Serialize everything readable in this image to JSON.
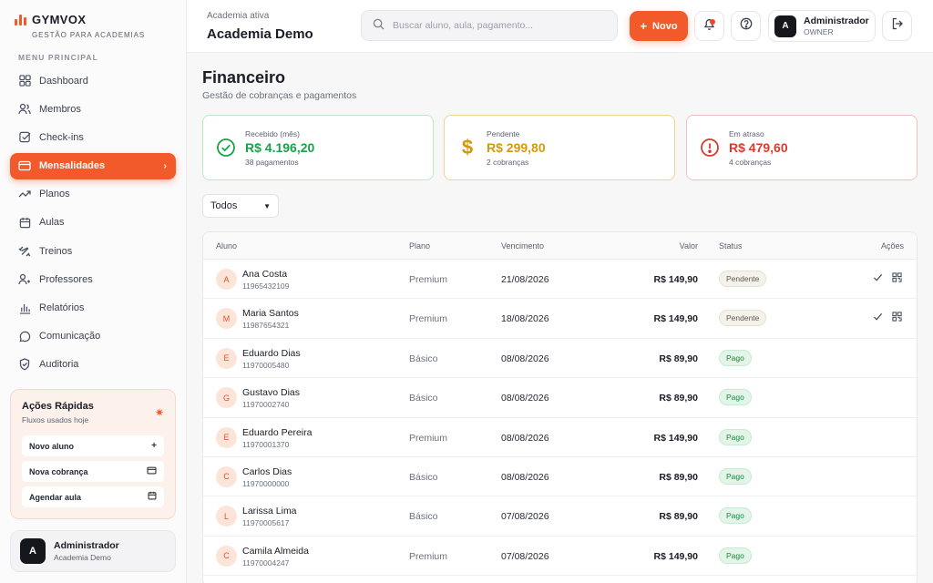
{
  "brand": {
    "name": "GYMVOX",
    "subtitle": "GESTÃO PARA ACADEMIAS"
  },
  "sidebar": {
    "menu_title": "MENU PRINCIPAL",
    "items": [
      {
        "label": "Dashboard",
        "icon": "grid-icon"
      },
      {
        "label": "Membros",
        "icon": "users-icon"
      },
      {
        "label": "Check-ins",
        "icon": "checkbox-icon"
      },
      {
        "label": "Mensalidades",
        "icon": "card-icon",
        "active": true
      },
      {
        "label": "Planos",
        "icon": "trend-icon"
      },
      {
        "label": "Aulas",
        "icon": "calendar-icon"
      },
      {
        "label": "Treinos",
        "icon": "workout-icon"
      },
      {
        "label": "Professores",
        "icon": "teacher-icon"
      },
      {
        "label": "Relatórios",
        "icon": "bars-icon"
      },
      {
        "label": "Comunicação",
        "icon": "chat-icon"
      },
      {
        "label": "Auditoria",
        "icon": "shield-icon"
      }
    ],
    "quick": {
      "title": "Ações Rápidas",
      "subtitle": "Fluxos usados hoje",
      "items": [
        {
          "label": "Novo aluno",
          "icon": "plus-icon"
        },
        {
          "label": "Nova cobrança",
          "icon": "card-icon"
        },
        {
          "label": "Agendar aula",
          "icon": "calendar-icon"
        }
      ]
    },
    "user": {
      "initial": "A",
      "name": "Administrador",
      "org": "Academia Demo"
    }
  },
  "header": {
    "academy_label": "Academia ativa",
    "academy_name": "Academia Demo",
    "search_placeholder": "Buscar aluno, aula, pagamento...",
    "new_label": "Novo",
    "admin": {
      "initial": "A",
      "name": "Administrador",
      "role": "OWNER"
    }
  },
  "page": {
    "title": "Financeiro",
    "subtitle": "Gestão de cobranças e pagamentos"
  },
  "cards": [
    {
      "label": "Recebido (mês)",
      "value": "R$ 4.196,20",
      "sub": "38 pagamentos",
      "color": "#17a34a"
    },
    {
      "label": "Pendente",
      "value": "R$ 299,80",
      "sub": "2 cobranças",
      "color": "#d29a0a"
    },
    {
      "label": "Em atraso",
      "value": "R$ 479,60",
      "sub": "4 cobranças",
      "color": "#d93b2b"
    }
  ],
  "filter": {
    "selected": "Todos"
  },
  "table": {
    "headers": {
      "aluno": "Aluno",
      "plano": "Plano",
      "vencimento": "Vencimento",
      "valor": "Valor",
      "status": "Status",
      "acoes": "Ações"
    },
    "rows": [
      {
        "initial": "A",
        "name": "Ana Costa",
        "phone": "11965432109",
        "plan": "Premium",
        "due": "21/08/2026",
        "value": "R$ 149,90",
        "status": "Pendente"
      },
      {
        "initial": "M",
        "name": "Maria Santos",
        "phone": "11987654321",
        "plan": "Premium",
        "due": "18/08/2026",
        "value": "R$ 149,90",
        "status": "Pendente"
      },
      {
        "initial": "E",
        "name": "Eduardo Dias",
        "phone": "11970005480",
        "plan": "Básico",
        "due": "08/08/2026",
        "value": "R$ 89,90",
        "status": "Pago"
      },
      {
        "initial": "G",
        "name": "Gustavo Dias",
        "phone": "11970002740",
        "plan": "Básico",
        "due": "08/08/2026",
        "value": "R$ 89,90",
        "status": "Pago"
      },
      {
        "initial": "E",
        "name": "Eduardo Pereira",
        "phone": "11970001370",
        "plan": "Premium",
        "due": "08/08/2026",
        "value": "R$ 149,90",
        "status": "Pago"
      },
      {
        "initial": "C",
        "name": "Carlos Dias",
        "phone": "11970000000",
        "plan": "Básico",
        "due": "08/08/2026",
        "value": "R$ 89,90",
        "status": "Pago"
      },
      {
        "initial": "L",
        "name": "Larissa Lima",
        "phone": "11970005617",
        "plan": "Básico",
        "due": "07/08/2026",
        "value": "R$ 89,90",
        "status": "Pago"
      },
      {
        "initial": "C",
        "name": "Camila Almeida",
        "phone": "11970004247",
        "plan": "Premium",
        "due": "07/08/2026",
        "value": "R$ 149,90",
        "status": "Pago"
      }
    ]
  },
  "colors": {
    "accent": "#f25a2b",
    "paid": "#168a3f",
    "pending": "#5c5a4e"
  }
}
